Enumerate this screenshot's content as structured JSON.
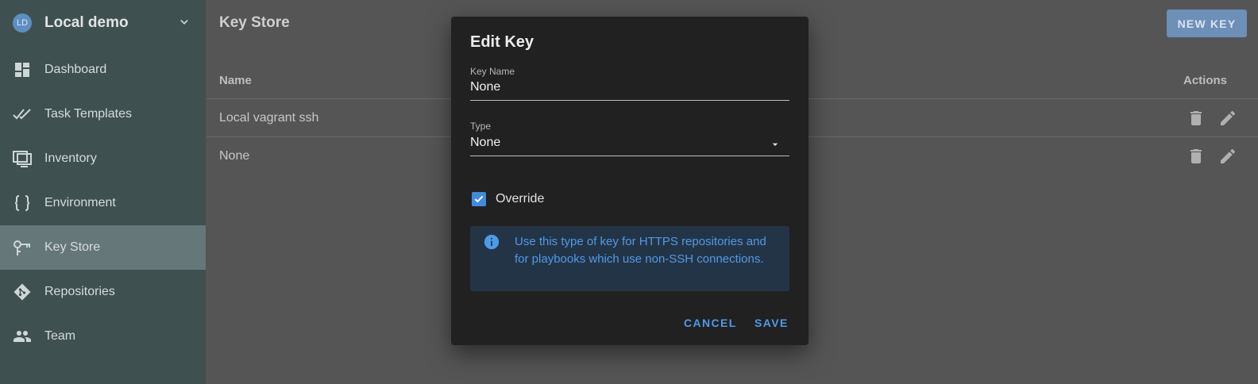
{
  "project": {
    "initials": "LD",
    "name": "Local demo"
  },
  "sidebar": {
    "items": [
      {
        "label": "Dashboard",
        "icon": "dashboard-icon"
      },
      {
        "label": "Task Templates",
        "icon": "double-check-icon"
      },
      {
        "label": "Inventory",
        "icon": "monitor-icon"
      },
      {
        "label": "Environment",
        "icon": "braces-icon"
      },
      {
        "label": "Key Store",
        "icon": "key-icon",
        "active": true
      },
      {
        "label": "Repositories",
        "icon": "git-icon"
      },
      {
        "label": "Team",
        "icon": "people-icon"
      }
    ]
  },
  "main": {
    "title": "Key Store",
    "new_key_label": "NEW KEY",
    "table": {
      "headers": {
        "name": "Name",
        "actions": "Actions"
      },
      "rows": [
        {
          "name": "Local vagrant ssh"
        },
        {
          "name": "None"
        }
      ]
    }
  },
  "dialog": {
    "title": "Edit Key",
    "key_name": {
      "label": "Key Name",
      "value": "None"
    },
    "type": {
      "label": "Type",
      "value": "None"
    },
    "override": {
      "label": "Override",
      "checked": true
    },
    "info": "Use this type of key for HTTPS repositories and for playbooks which use non-SSH connections.",
    "cancel_label": "CANCEL",
    "save_label": "SAVE"
  },
  "colors": {
    "accent": "#4e9ae8",
    "button": "#6d8fb8",
    "sidebar": "#3f5050",
    "sidebar_active": "#66777a",
    "dialog": "#212121",
    "info_bg": "#243447"
  }
}
